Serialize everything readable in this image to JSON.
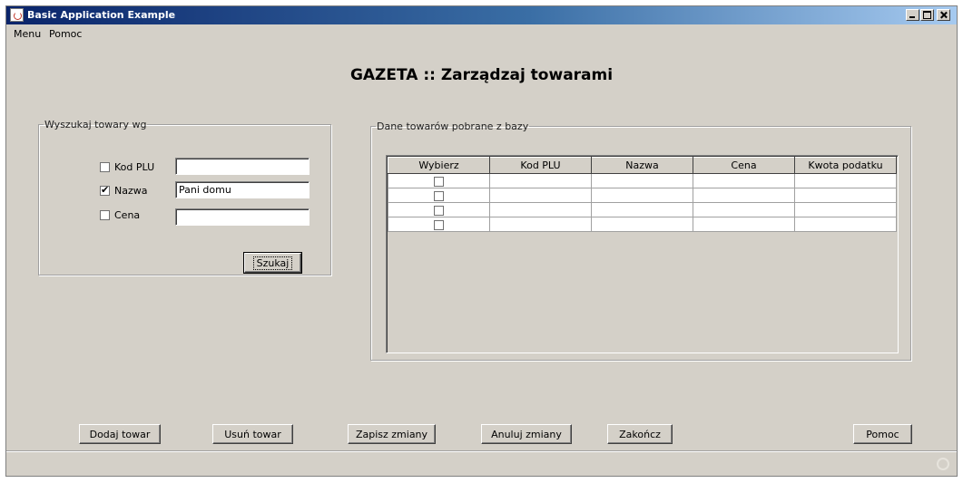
{
  "window": {
    "title": "Basic Application Example"
  },
  "menu": {
    "items": [
      "Menu",
      "Pomoc"
    ]
  },
  "heading": "GAZETA :: Zarządzaj towarami",
  "search": {
    "legend": "Wyszukaj towary wg",
    "kod_plu": {
      "label": "Kod PLU",
      "checked": false,
      "value": ""
    },
    "nazwa": {
      "label": "Nazwa",
      "checked": true,
      "value": "Pani domu"
    },
    "cena": {
      "label": "Cena",
      "checked": false,
      "value": ""
    },
    "button": "Szukaj"
  },
  "results": {
    "legend": "Dane towarów pobrane z bazy",
    "columns": [
      "Wybierz",
      "Kod PLU",
      "Nazwa",
      "Cena",
      "Kwota podatku"
    ],
    "rows": [
      {
        "selected": false,
        "kod_plu": "",
        "nazwa": "",
        "cena": "",
        "kwota_podatku": ""
      },
      {
        "selected": false,
        "kod_plu": "",
        "nazwa": "",
        "cena": "",
        "kwota_podatku": ""
      },
      {
        "selected": false,
        "kod_plu": "",
        "nazwa": "",
        "cena": "",
        "kwota_podatku": ""
      },
      {
        "selected": false,
        "kod_plu": "",
        "nazwa": "",
        "cena": "",
        "kwota_podatku": ""
      }
    ]
  },
  "buttons": {
    "dodaj": "Dodaj towar",
    "usun": "Usuń towar",
    "zapisz": "Zapisz zmiany",
    "anuluj": "Anuluj zmiany",
    "zakoncz": "Zakończ",
    "pomoc": "Pomoc"
  },
  "icons": {
    "app": "java-coffee-cup-icon",
    "minimize": "minimize-icon",
    "maximize": "maximize-icon",
    "close": "close-icon"
  },
  "colors": {
    "window_bg": "#d4d0c8",
    "titlebar_start": "#0a246a",
    "titlebar_end": "#a6caf0"
  }
}
